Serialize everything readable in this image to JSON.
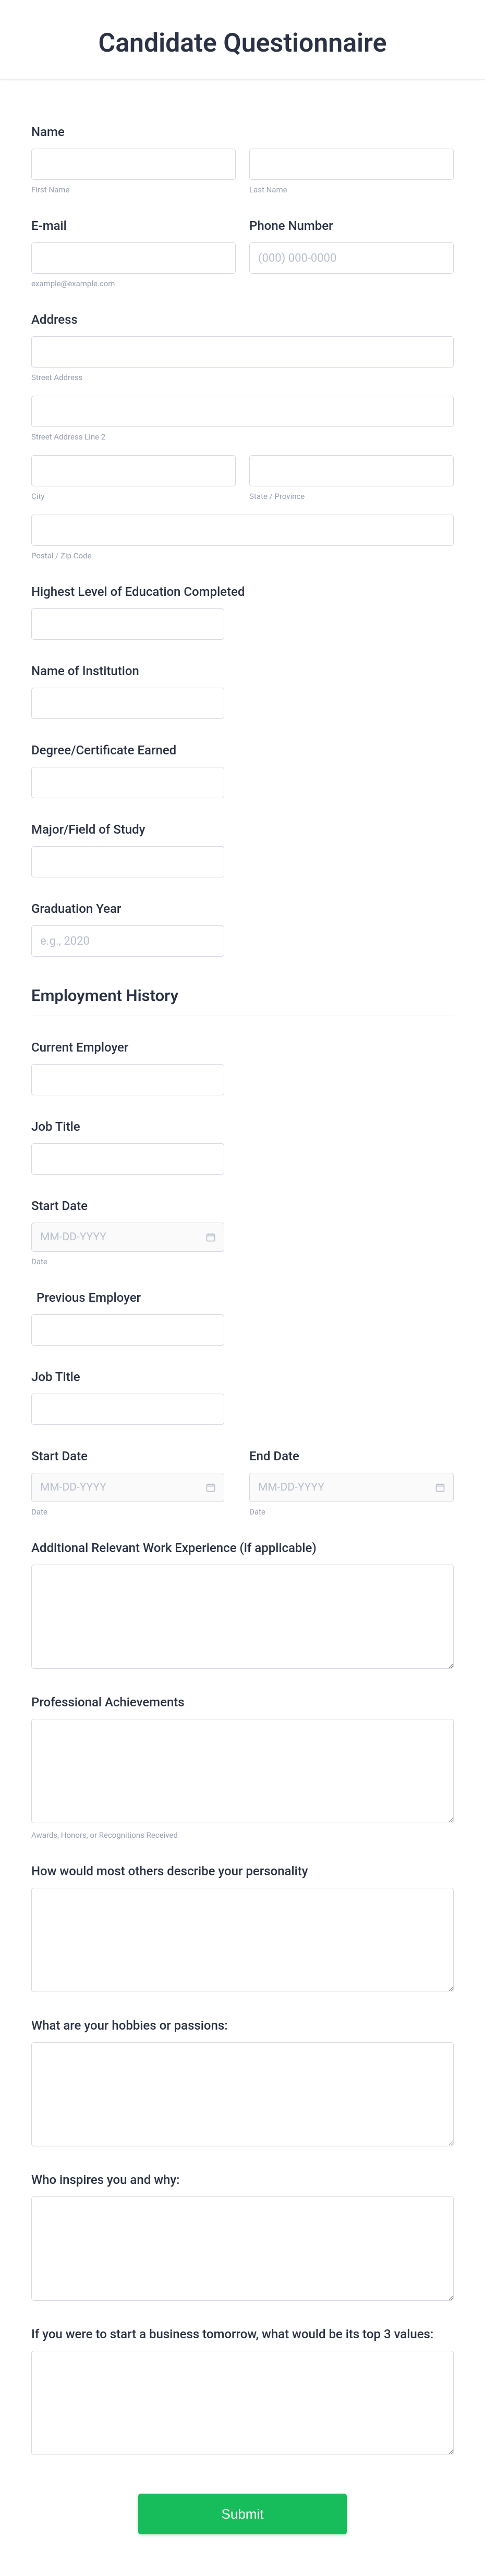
{
  "title": "Candidate Questionnaire",
  "name": {
    "label": "Name",
    "first_sub": "First Name",
    "last_sub": "Last Name"
  },
  "email": {
    "label": "E-mail",
    "sub": "example@example.com"
  },
  "phone": {
    "label": "Phone Number",
    "placeholder": "(000) 000-0000"
  },
  "address": {
    "label": "Address",
    "street_sub": "Street Address",
    "street2_sub": "Street Address Line 2",
    "city_sub": "City",
    "state_sub": "State / Province",
    "postal_sub": "Postal / Zip Code"
  },
  "education": {
    "level": "Highest Level of Education Completed",
    "institution": "Name of Institution",
    "degree": "Degree/Certificate Earned",
    "major": "Major/Field of Study",
    "grad_year": "Graduation Year",
    "grad_year_placeholder": "e.g., 2020"
  },
  "employment": {
    "heading": "Employment History",
    "current": "Current Employer",
    "job_title": "Job Title",
    "start_date": "Start Date",
    "end_date": "End Date",
    "date_placeholder": "MM-DD-YYYY",
    "date_sub": "Date",
    "previous": "Previous Employer",
    "additional": "Additional Relevant Work Experience (if applicable)",
    "achievements": "Professional Achievements",
    "achievements_sub": "Awards, Honors, or Recognitions Received"
  },
  "personal": {
    "personality": "How would most others describe your personality",
    "hobbies": "What are your hobbies or passions:",
    "inspires": "Who inspires you and why:",
    "business": "If you were to start a business tomorrow, what would be its top 3 values:"
  },
  "submit": "Submit"
}
